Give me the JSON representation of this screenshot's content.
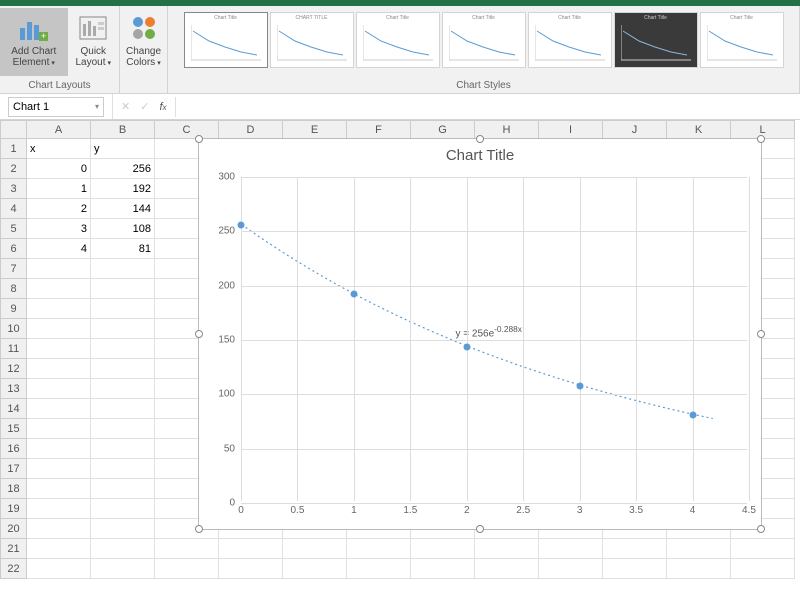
{
  "ribbon": {
    "chart_layouts_label": "Chart Layouts",
    "chart_styles_label": "Chart Styles",
    "add_chart_element": "Add Chart\nElement",
    "quick_layout": "Quick\nLayout",
    "change_colors": "Change\nColors",
    "style_thumbs": [
      {
        "title": "Chart Title",
        "selected": true,
        "dark": false
      },
      {
        "title": "CHART TITLE",
        "selected": false,
        "dark": false
      },
      {
        "title": "Chart Title",
        "selected": false,
        "dark": false
      },
      {
        "title": "Chart Title",
        "selected": false,
        "dark": false
      },
      {
        "title": "Chart Title",
        "selected": false,
        "dark": false
      },
      {
        "title": "Chart Title",
        "selected": false,
        "dark": true
      },
      {
        "title": "Chart Title",
        "selected": false,
        "dark": false
      }
    ]
  },
  "name_box": "Chart 1",
  "formula_bar": "",
  "columns": [
    "A",
    "B",
    "C",
    "D",
    "E",
    "F",
    "G",
    "H",
    "I",
    "J",
    "K",
    "L"
  ],
  "rows": 22,
  "cells": {
    "A1": "x",
    "B1": "y",
    "A2": "0",
    "B2": "256",
    "A3": "1",
    "B3": "192",
    "A4": "2",
    "B4": "144",
    "A5": "3",
    "B5": "108",
    "A6": "4",
    "B6": "81"
  },
  "chart": {
    "title": "Chart Title",
    "trend_equation": "y = 256e",
    "trend_exponent": "-0.288x"
  },
  "chart_data": {
    "type": "scatter",
    "title": "Chart Title",
    "xlabel": "",
    "ylabel": "",
    "xlim": [
      0,
      4.5
    ],
    "ylim": [
      0,
      300
    ],
    "xticks": [
      0,
      0.5,
      1,
      1.5,
      2,
      2.5,
      3,
      3.5,
      4,
      4.5
    ],
    "yticks": [
      0,
      50,
      100,
      150,
      200,
      250,
      300
    ],
    "series": [
      {
        "name": "y",
        "x": [
          0,
          1,
          2,
          3,
          4
        ],
        "y": [
          256,
          192,
          144,
          108,
          81
        ]
      }
    ],
    "trendline": {
      "type": "exponential",
      "equation": "y = 256e^(-0.288x)"
    }
  }
}
